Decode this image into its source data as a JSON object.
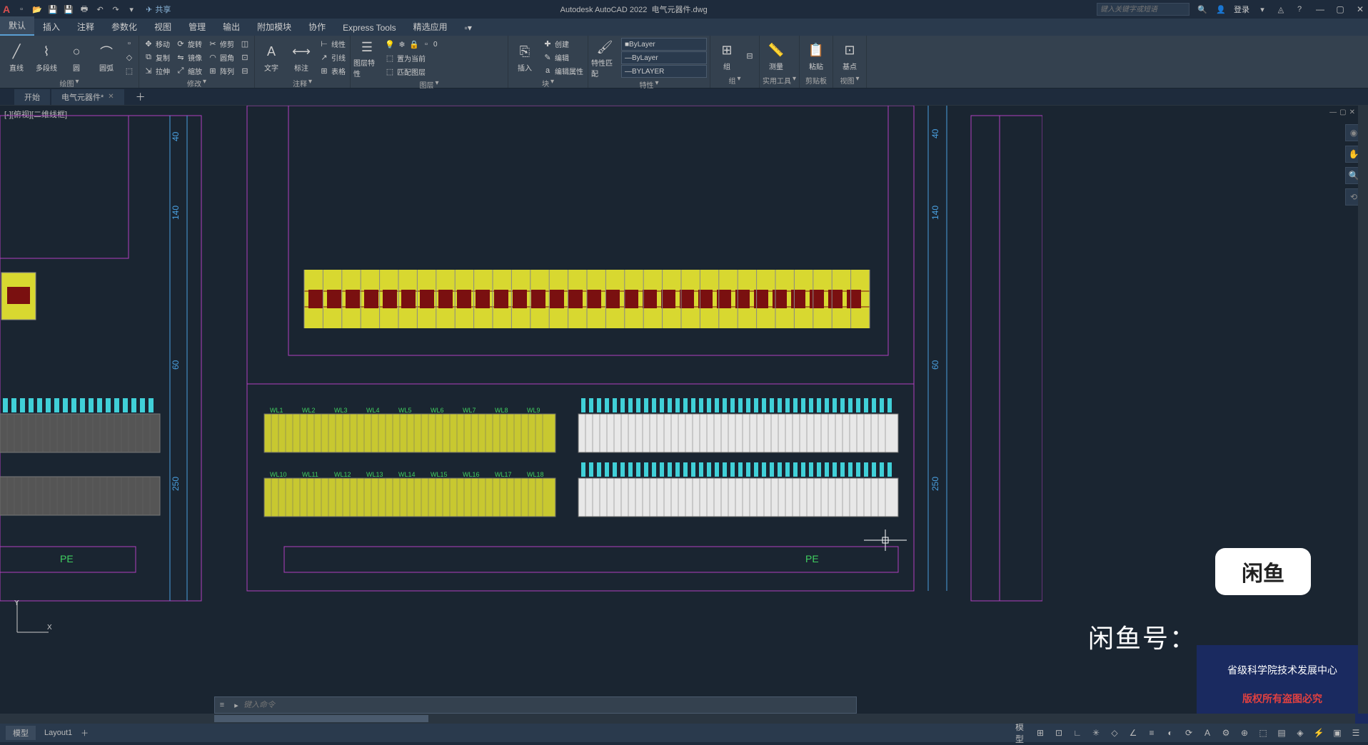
{
  "title": {
    "app": "Autodesk AutoCAD 2022",
    "file": "电气元器件.dwg"
  },
  "qat_share": "共享",
  "search_placeholder": "键入关键字或短语",
  "login": "登录",
  "menubar": [
    "默认",
    "插入",
    "注释",
    "参数化",
    "视图",
    "管理",
    "输出",
    "附加模块",
    "协作",
    "Express Tools",
    "精选应用"
  ],
  "ribbon": {
    "draw": {
      "line": "直线",
      "polyline": "多段线",
      "circle": "圆",
      "arc": "圆弧",
      "title": "绘图"
    },
    "modify": {
      "move": "移动",
      "rotate": "旋转",
      "trim": "修剪",
      "copy": "复制",
      "mirror": "镜像",
      "fillet": "圆角",
      "stretch": "拉伸",
      "scale": "缩放",
      "array": "阵列",
      "title": "修改"
    },
    "annot": {
      "text": "文字",
      "dim": "标注",
      "leader": "引线",
      "table": "表格",
      "linear": "线性",
      "title": "注释"
    },
    "layer": {
      "props": "图层特性",
      "setcurrent": "置为当前",
      "match": "匹配图层",
      "title": "图层"
    },
    "block": {
      "insert": "插入",
      "create": "创建",
      "edit": "编辑",
      "attr": "编辑属性",
      "title": "块"
    },
    "props": {
      "match": "特性匹配",
      "bylayer": "ByLayer",
      "bylayer2": "ByLayer",
      "bylayer3": "BYLAYER",
      "title": "特性"
    },
    "group": {
      "group": "组",
      "title": "组"
    },
    "util": {
      "measure": "测量",
      "title": "实用工具"
    },
    "clip": {
      "paste": "粘贴",
      "title": "剪贴板"
    },
    "view": {
      "base": "基点",
      "title": "视图"
    }
  },
  "doctabs": {
    "start": "开始",
    "active": "电气元器件*"
  },
  "viewport_label": "[-][俯视][二维线框]",
  "dims": {
    "d40a": "40",
    "d140a": "140",
    "d60a": "60",
    "d250a": "250",
    "d40b": "40",
    "d140b": "140",
    "d60b": "60",
    "d250b": "250"
  },
  "pe1": "PE",
  "pe2": "PE",
  "terminal_labels_row1": [
    "WL1",
    "WL2",
    "WL3",
    "WL4",
    "WL5",
    "WL6",
    "WL7",
    "WL8",
    "WL9"
  ],
  "terminal_labels_row2": [
    "WL10",
    "WL11",
    "WL12",
    "WL13",
    "WL14",
    "WL15",
    "WL16",
    "WL17",
    "WL18"
  ],
  "overlay": {
    "logo": "闲鱼",
    "text": "闲鱼号：",
    "band_line1": "省级科学院技术发展中心",
    "band_line2": "版权所有盗图必究"
  },
  "cmd_placeholder": "键入命令",
  "status": {
    "model": "模型",
    "layout": "Layout1",
    "model2": "模型"
  }
}
